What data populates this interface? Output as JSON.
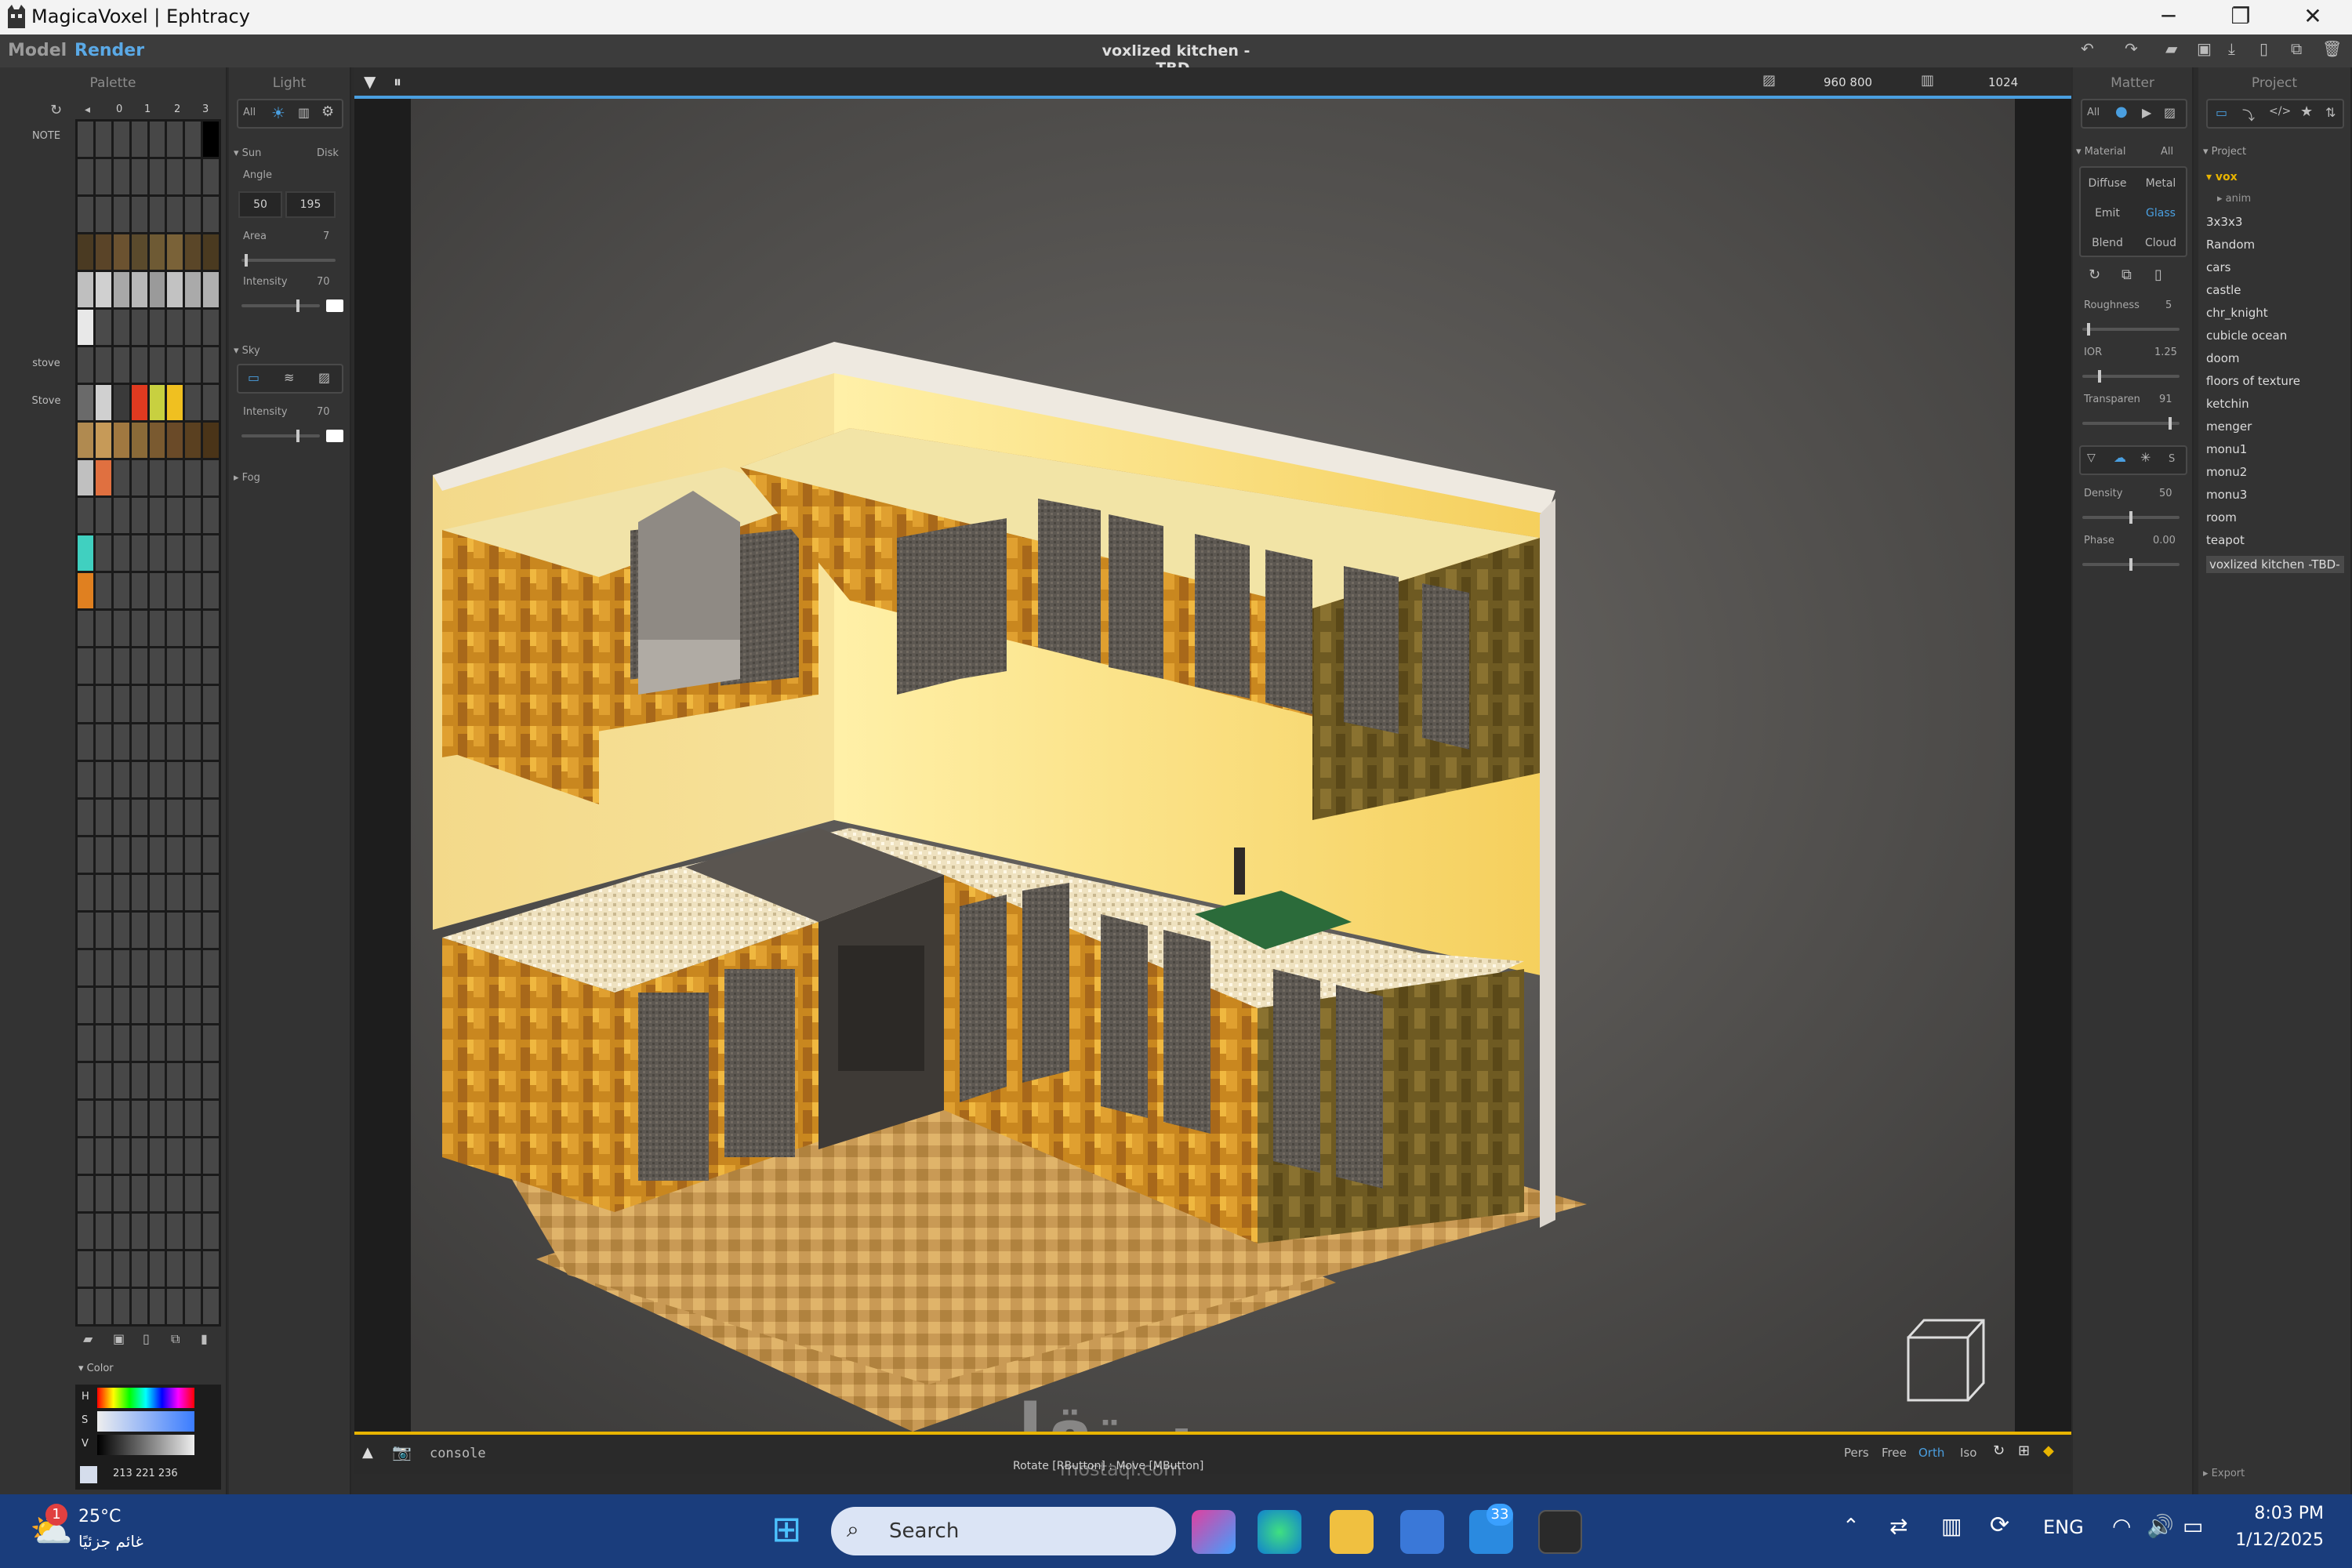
{
  "window": {
    "title": "MagicaVoxel | Ephtracy",
    "icon": "magicavoxel-logo-icon"
  },
  "menu": {
    "model": "Model",
    "render": "Render",
    "document_title": "voxlized kitchen -TBD-"
  },
  "palette": {
    "title": "Palette",
    "columns": [
      "0",
      "1",
      "2",
      "3"
    ],
    "labels": {
      "note": "NOTE",
      "stove_lower": "stove",
      "stove_upper": "Stove"
    },
    "color_title": "Color",
    "hsv": [
      "H",
      "S",
      "V"
    ],
    "rgb": "213  221  236",
    "selected_color": "#d5ddec"
  },
  "light": {
    "title": "Light",
    "all": "All",
    "sun": "Sun",
    "disk": "Disk",
    "angle": "Angle",
    "angle_values": [
      "50",
      "195"
    ],
    "area": "Area",
    "area_value": "7",
    "intensity": "Intensity",
    "intensity_value": "70",
    "sky": "Sky",
    "sky_intensity": "Intensity",
    "sky_intensity_value": "70",
    "fog": "Fog"
  },
  "viewport": {
    "resolution": "960  800",
    "samples": "1024",
    "console": "console",
    "status": "Rotate [RButton] : Move [MButton]",
    "camera_modes": [
      "Pers",
      "Free",
      "Orth",
      "Iso"
    ],
    "active_camera": "Orth",
    "watermark": "مستقل",
    "watermark_sub": "mostaql.com"
  },
  "matter": {
    "title": "Matter",
    "all": "All",
    "material": "Material",
    "material_all": "All",
    "types": [
      "Diffuse",
      "Metal",
      "Emit",
      "Glass",
      "Blend",
      "Cloud"
    ],
    "active_type": "Glass",
    "roughness": "Roughness",
    "roughness_value": "5",
    "ior": "IOR",
    "ior_value": "1.25",
    "transparency": "Transparen",
    "transparency_value": "91",
    "density": "Density",
    "density_value": "50",
    "phase": "Phase",
    "phase_value": "0.00",
    "s_label": "S"
  },
  "project": {
    "title": "Project",
    "section": "Project",
    "folder": "vox",
    "subfolder": "anim",
    "files": [
      "3x3x3",
      "Random",
      "cars",
      "castle",
      "chr_knight",
      "cubicle ocean",
      "doom",
      "floors of texture",
      "ketchin",
      "menger",
      "monu1",
      "monu2",
      "monu3",
      "room",
      "teapot",
      "voxlized kitchen -TBD-"
    ],
    "selected": "voxlized kitchen -TBD-",
    "export": "Export"
  },
  "taskbar": {
    "weather_temp": "25°C",
    "weather_desc": "غائم جزئيًا",
    "weather_badge": "1",
    "search": "Search",
    "mail_badge": "33",
    "lang": "ENG",
    "time": "8:03 PM",
    "date": "1/12/2025"
  }
}
